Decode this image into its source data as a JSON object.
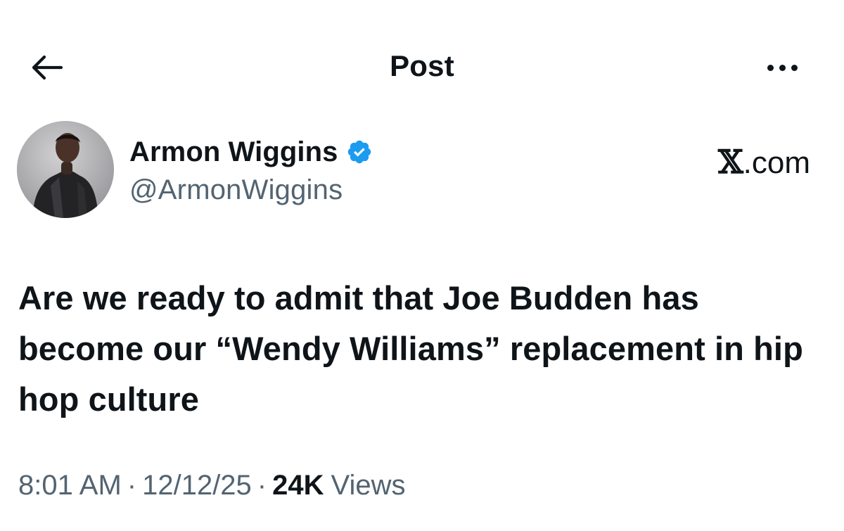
{
  "header": {
    "title": "Post",
    "back_icon": "arrow-left-icon",
    "more_icon": "more-horizontal-icon"
  },
  "author": {
    "display_name": "Armon Wiggins",
    "handle": "@ArmonWiggins",
    "verified_badge_icon": "verified-badge-icon",
    "verified_color": "#1d9bf0"
  },
  "brand": {
    "x_letter": "𝕏",
    "suffix": ".com"
  },
  "post": {
    "text": "Are we ready to admit that Joe Budden has become our “Wendy Williams” replacement in hip hop culture"
  },
  "meta": {
    "time": "8:01 AM",
    "separator": "·",
    "date": "12/12/25",
    "views_count": "24K",
    "views_label": "Views"
  },
  "colors": {
    "text_primary": "#0f1419",
    "text_secondary": "#536471",
    "background": "#ffffff"
  }
}
